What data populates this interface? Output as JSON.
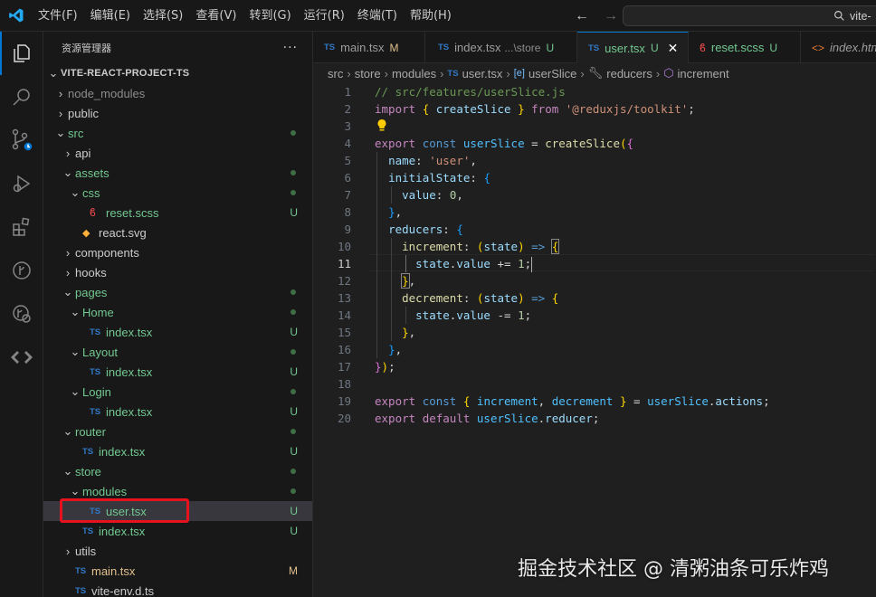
{
  "menu": [
    "文件(F)",
    "编辑(E)",
    "选择(S)",
    "查看(V)",
    "转到(G)",
    "运行(R)",
    "终端(T)",
    "帮助(H)"
  ],
  "command_center": {
    "text": "vite-"
  },
  "sidebar": {
    "title": "资源管理器",
    "more": "···",
    "project": "VITE-REACT-PROJECT-TS",
    "rows": [
      {
        "label": "node_modules",
        "chev": "›",
        "color": "gray"
      },
      {
        "label": "public",
        "chev": "›",
        "color": "plain"
      },
      {
        "label": "src",
        "chev": "⌄",
        "color": "green",
        "dot": true
      },
      {
        "label": "api",
        "chev": "›",
        "color": "plain"
      },
      {
        "label": "assets",
        "chev": "⌄",
        "color": "green",
        "dot": true
      },
      {
        "label": "css",
        "chev": "⌄",
        "color": "green",
        "dot": true
      },
      {
        "label": "reset.scss",
        "icon": "scss",
        "color": "green",
        "status": "U"
      },
      {
        "label": "react.svg",
        "icon": "svg",
        "color": "plain"
      },
      {
        "label": "components",
        "chev": "›",
        "color": "plain"
      },
      {
        "label": "hooks",
        "chev": "›",
        "color": "plain"
      },
      {
        "label": "pages",
        "chev": "⌄",
        "color": "green",
        "dot": true
      },
      {
        "label": "Home",
        "chev": "⌄",
        "color": "green",
        "dot": true
      },
      {
        "label": "index.tsx",
        "icon": "ts",
        "color": "green",
        "status": "U"
      },
      {
        "label": "Layout",
        "chev": "⌄",
        "color": "green",
        "dot": true
      },
      {
        "label": "index.tsx",
        "icon": "ts",
        "color": "green",
        "status": "U"
      },
      {
        "label": "Login",
        "chev": "⌄",
        "color": "green",
        "dot": true
      },
      {
        "label": "index.tsx",
        "icon": "ts",
        "color": "green",
        "status": "U"
      },
      {
        "label": "router",
        "chev": "⌄",
        "color": "green",
        "dot": true
      },
      {
        "label": "index.tsx",
        "icon": "ts",
        "color": "green",
        "status": "U"
      },
      {
        "label": "store",
        "chev": "⌄",
        "color": "green",
        "dot": true
      },
      {
        "label": "modules",
        "chev": "⌄",
        "color": "green",
        "dot": true
      },
      {
        "label": "user.tsx",
        "icon": "ts",
        "color": "green",
        "status": "U",
        "selected": true
      },
      {
        "label": "index.tsx",
        "icon": "ts",
        "color": "green",
        "status": "U"
      },
      {
        "label": "utils",
        "chev": "›",
        "color": "plain"
      },
      {
        "label": "main.tsx",
        "icon": "ts",
        "color": "mod",
        "status": "M"
      },
      {
        "label": "vite-env.d.ts",
        "icon": "ts",
        "color": "plain"
      }
    ]
  },
  "tabs": [
    {
      "label": "main.tsx",
      "status": "M"
    },
    {
      "label": "index.tsx",
      "desc": "...\\store",
      "status": "U"
    },
    {
      "label": "user.tsx",
      "status": "U",
      "active": true
    },
    {
      "label": "reset.scss",
      "status": "U"
    },
    {
      "label": "index.htm"
    }
  ],
  "breadcrumbs": [
    "src",
    "store",
    "modules",
    "user.tsx",
    "userSlice",
    "reducers",
    "increment"
  ],
  "editor": {
    "current_line": 11,
    "line_numbers": [
      "1",
      "2",
      "3",
      "4",
      "5",
      "6",
      "7",
      "8",
      "9",
      "10",
      "11",
      "12",
      "13",
      "14",
      "15",
      "16",
      "17",
      "18",
      "19",
      "20"
    ]
  },
  "watermark": "掘金技术社区 @ 清粥油条可乐炸鸡",
  "colors": {
    "accent": "#0078d4",
    "untracked": "#73c991",
    "modified": "#e2c08d",
    "highlight_box": "#e8121e"
  }
}
